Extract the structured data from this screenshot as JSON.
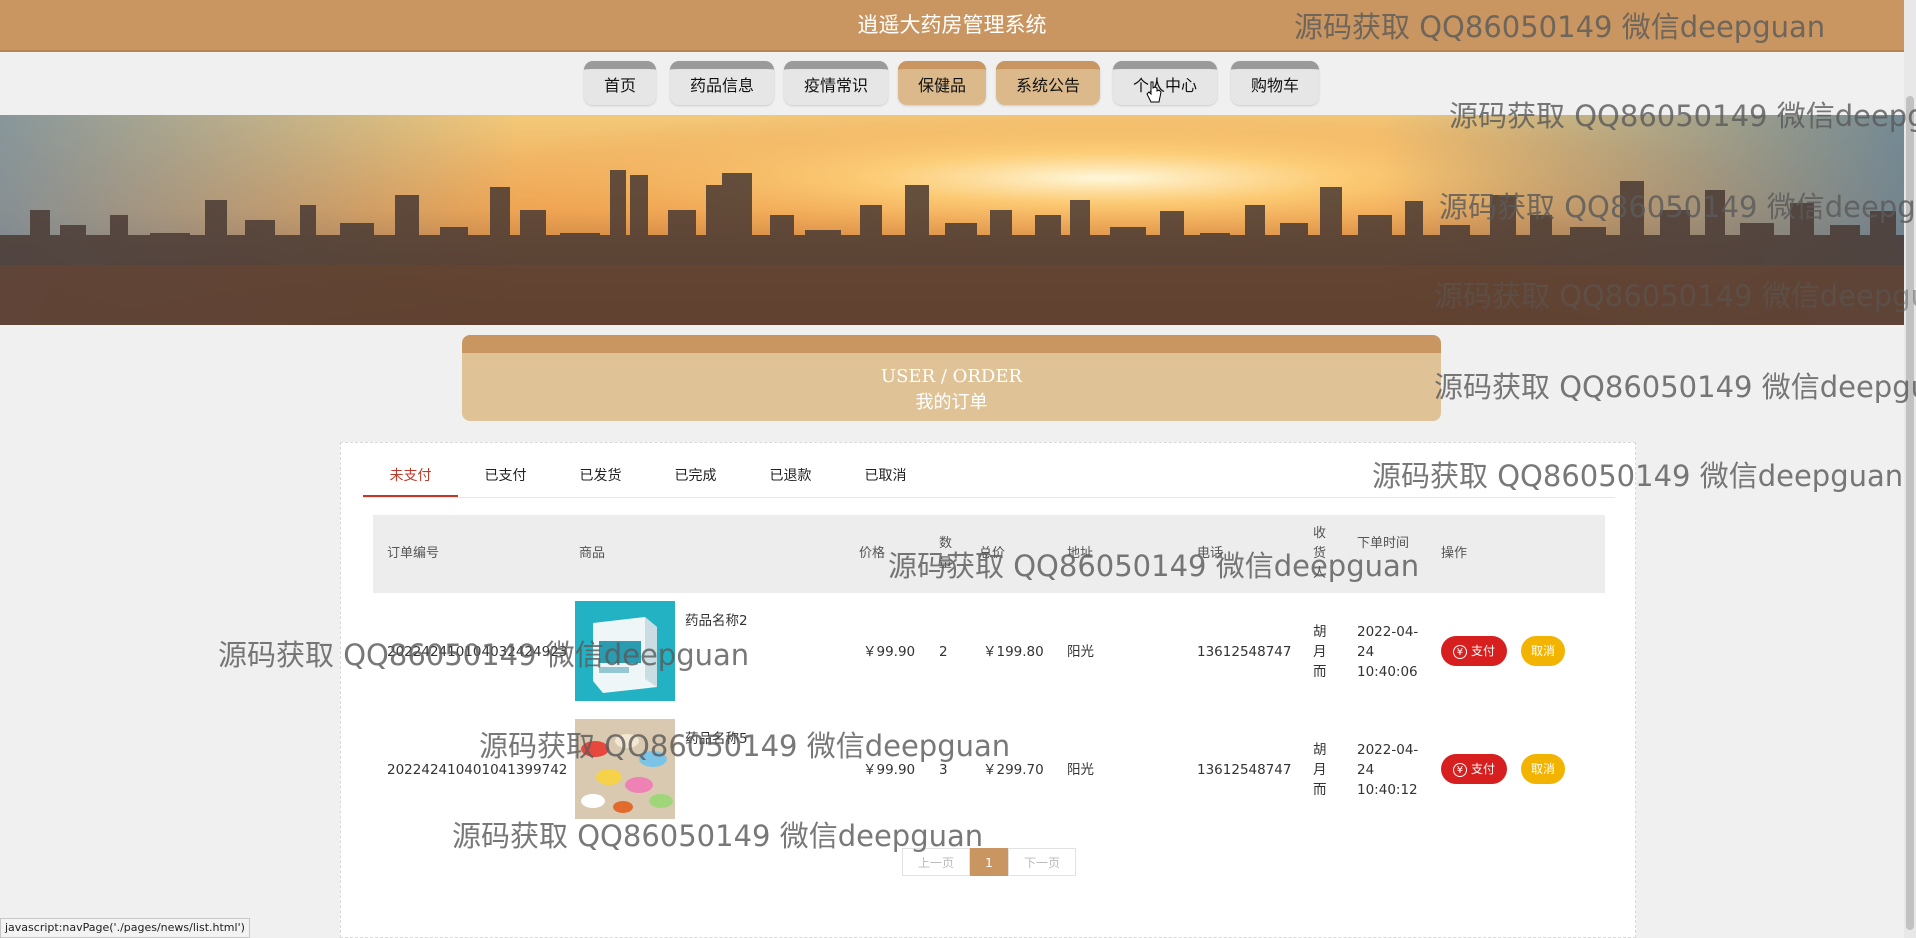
{
  "header": {
    "title": "逍遥大药房管理系统"
  },
  "nav": {
    "home": "首页",
    "drugs": "药品信息",
    "epidemic": "疫情常识",
    "health": "保健品",
    "notice": "系统公告",
    "personal": "个人中心",
    "cart": "购物车"
  },
  "order_header": {
    "en": "USER / ORDER",
    "cn": "我的订单"
  },
  "tabs": {
    "unpaid": "未支付",
    "paid": "已支付",
    "shipped": "已发货",
    "completed": "已完成",
    "refunded": "已退款",
    "cancelled": "已取消"
  },
  "table": {
    "headers": {
      "order_no": "订单编号",
      "product": "商品",
      "price": "价格",
      "qty": "数量",
      "total": "总价",
      "address": "地址",
      "phone": "电话",
      "receiver": "收货人",
      "time": "下单时间",
      "actions": "操作"
    },
    "rows": [
      {
        "order_no": "202242410104032424923",
        "product_name": "药品名称2",
        "price": "￥99.90",
        "qty": "2",
        "total": "￥199.80",
        "address": "阳光",
        "phone": "13612548747",
        "receiver": "胡月而",
        "time": "2022-04-24 10:40:06"
      },
      {
        "order_no": "202242410401041399742",
        "product_name": "药品名称5",
        "price": "￥99.90",
        "qty": "3",
        "total": "￥299.70",
        "address": "阳光",
        "phone": "13612548747",
        "receiver": "胡月而",
        "time": "2022-04-24 10:40:12"
      }
    ],
    "pay_label": "支付",
    "cancel_label": "取消"
  },
  "pager": {
    "prev": "上一页",
    "current": "1",
    "next": "下一页"
  },
  "watermark": "源码获取 QQ86050149 微信deepguan",
  "statusbar": {
    "url": "javascript:navPage('./pages/news/list.html')"
  },
  "colors": {
    "brand": "#c99662",
    "brand_light": "#dfc397",
    "pay": "#d71f1f",
    "cancel": "#f2b400",
    "active_tab": "#c0392b"
  }
}
